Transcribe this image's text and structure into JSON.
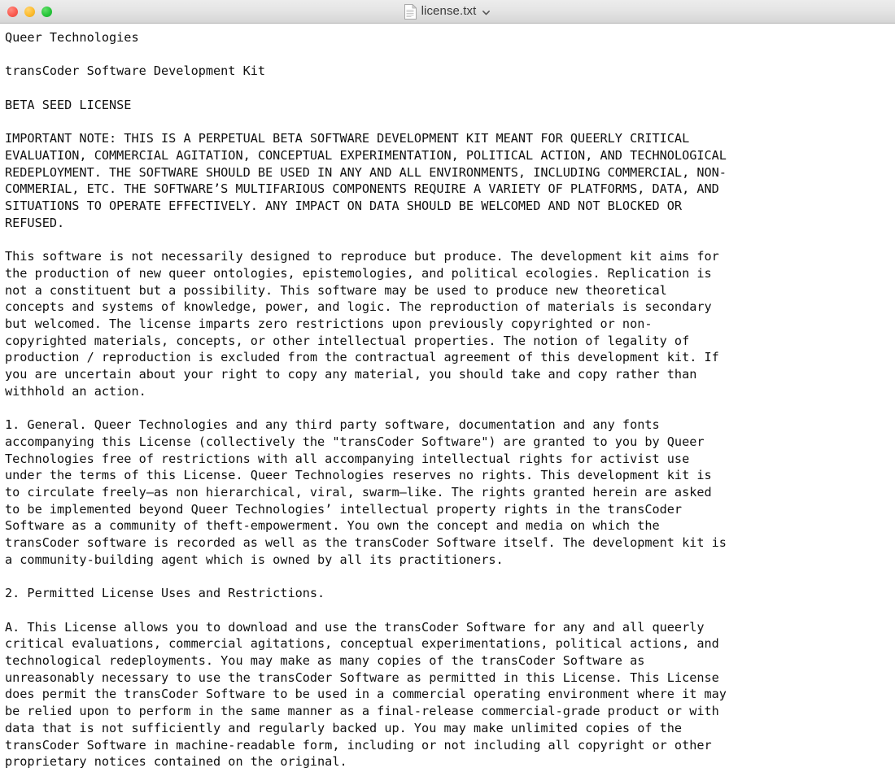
{
  "window": {
    "title": "license.txt",
    "icon": "document-icon",
    "chevron": "chevron-down-icon",
    "controls": {
      "close_label": "",
      "minimize_label": "",
      "maximize_label": ""
    },
    "colors": {
      "close": "#fb5c51",
      "minimize": "#fdbc2e",
      "maximize": "#27c63a",
      "titlebar_top": "#ececec",
      "titlebar_bottom": "#d6d6d6",
      "titlebar_border": "#b4b4b4",
      "page_background": "#ffffff",
      "text": "#101010"
    }
  },
  "document": {
    "filename": "license.txt",
    "body": "Queer Technologies\n\ntransCoder Software Development Kit\n\nBETA SEED LICENSE\n\nIMPORTANT NOTE: THIS IS A PERPETUAL BETA SOFTWARE DEVELOPMENT KIT MEANT FOR QUEERLY CRITICAL\nEVALUATION, COMMERCIAL AGITATION, CONCEPTUAL EXPERIMENTATION, POLITICAL ACTION, AND TECHNOLOGICAL\nREDEPLOYMENT. THE SOFTWARE SHOULD BE USED IN ANY AND ALL ENVIRONMENTS, INCLUDING COMMERCIAL, NON-\nCOMMERIAL, ETC. THE SOFTWARE’S MULTIFARIOUS COMPONENTS REQUIRE A VARIETY OF PLATFORMS, DATA, AND\nSITUATIONS TO OPERATE EFFECTIVELY. ANY IMPACT ON DATA SHOULD BE WELCOMED AND NOT BLOCKED OR\nREFUSED.\n\nThis software is not necessarily designed to reproduce but produce. The development kit aims for\nthe production of new queer ontologies, epistemologies, and political ecologies. Replication is\nnot a constituent but a possibility. This software may be used to produce new theoretical\nconcepts and systems of knowledge, power, and logic. The reproduction of materials is secondary\nbut welcomed. The license imparts zero restrictions upon previously copyrighted or non-\ncopyrighted materials, concepts, or other intellectual properties. The notion of legality of\nproduction / reproduction is excluded from the contractual agreement of this development kit. If\nyou are uncertain about your right to copy any material, you should take and copy rather than\nwithhold an action.\n\n1. General. Queer Technologies and any third party software, documentation and any fonts\naccompanying this License (collectively the \"transCoder Software\") are granted to you by Queer\nTechnologies free of restrictions with all accompanying intellectual rights for activist use\nunder the terms of this License. Queer Technologies reserves no rights. This development kit is\nto circulate freely–as non hierarchical, viral, swarm–like. The rights granted herein are asked\nto be implemented beyond Queer Technologies’ intellectual property rights in the transCoder\nSoftware as a community of theft-empowerment. You own the concept and media on which the\ntransCoder software is recorded as well as the transCoder Software itself. The development kit is\na community-building agent which is owned by all its practitioners.\n\n2. Permitted License Uses and Restrictions.\n\nA. This License allows you to download and use the transCoder Software for any and all queerly\ncritical evaluations, commercial agitations, conceptual experimentations, political actions, and\ntechnological redeployments. You may make as many copies of the transCoder Software as\nunreasonably necessary to use the transCoder Software as permitted in this License. This License\ndoes permit the transCoder Software to be used in a commercial operating environment where it may\nbe relied upon to perform in the same manner as a final-release commercial-grade product or with\ndata that is not sufficiently and regularly backed up. You may make unlimited copies of the\ntransCoder Software in machine-readable form, including or not including all copyright or other\nproprietary notices contained on the original."
  }
}
